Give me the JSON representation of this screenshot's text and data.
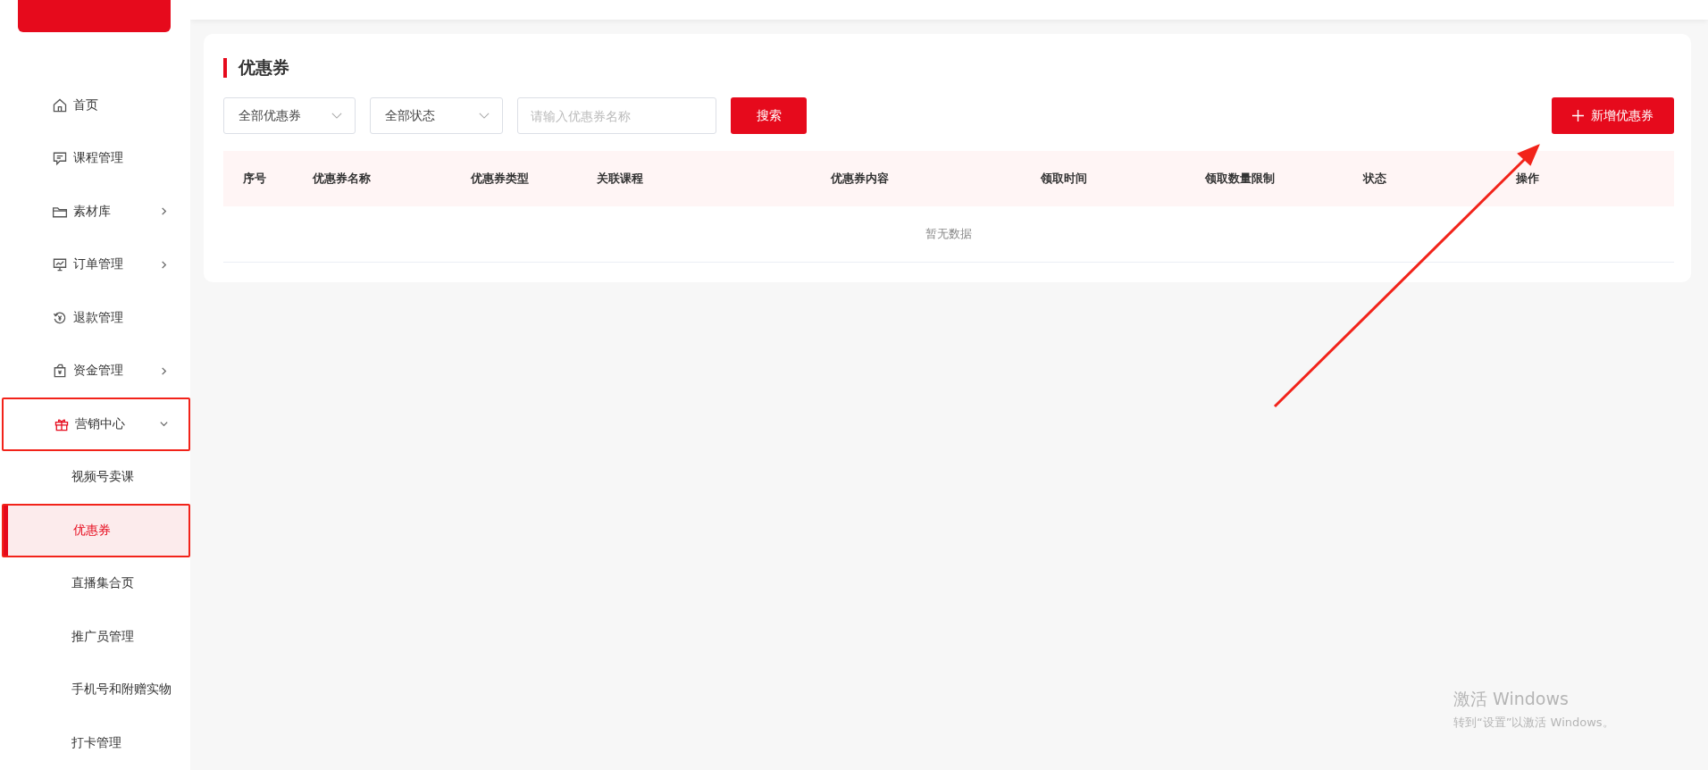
{
  "sidebar": {
    "items": [
      {
        "label": "首页",
        "kind": "link",
        "annotated": false
      },
      {
        "label": "课程管理",
        "kind": "link",
        "annotated": false
      },
      {
        "label": "素材库",
        "kind": "group",
        "expanded": false,
        "annotated": false
      },
      {
        "label": "订单管理",
        "kind": "group",
        "expanded": false,
        "annotated": false
      },
      {
        "label": "退款管理",
        "kind": "link",
        "annotated": false
      },
      {
        "label": "资金管理",
        "kind": "group",
        "expanded": false,
        "annotated": false
      },
      {
        "label": "营销中心",
        "kind": "group",
        "expanded": true,
        "annotated": true,
        "children": [
          {
            "label": "视频号卖课",
            "selected": false,
            "annotated": false
          },
          {
            "label": "优惠券",
            "selected": true,
            "annotated": true
          },
          {
            "label": "直播集合页",
            "selected": false,
            "annotated": false
          },
          {
            "label": "推广员管理",
            "selected": false,
            "annotated": false
          },
          {
            "label": "手机号和附赠实物",
            "selected": false,
            "annotated": false
          },
          {
            "label": "打卡管理",
            "selected": false,
            "annotated": false
          }
        ]
      }
    ]
  },
  "page": {
    "title": "优惠券",
    "filters": {
      "type_select": "全部优惠券",
      "status_select": "全部状态",
      "search": {
        "placeholder": "请输入优惠券名称"
      },
      "search_button": "搜索"
    },
    "add_button": "新增优惠券",
    "table": {
      "columns": [
        "序号",
        "优惠券名称",
        "优惠券类型",
        "关联课程",
        "优惠券内容",
        "领取时间",
        "领取数量限制",
        "状态",
        "操作"
      ],
      "empty_text": "暂无数据"
    }
  },
  "os_notice": {
    "title": "激活 Windows",
    "text": "转到“设置”以激活 Windows。"
  }
}
